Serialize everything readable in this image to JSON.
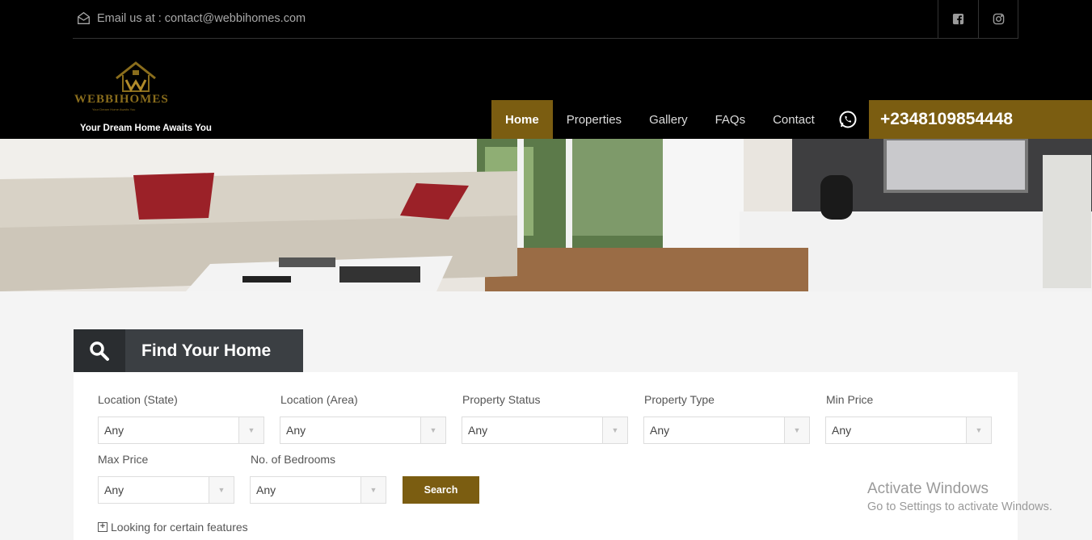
{
  "topbar": {
    "email_text": "Email us at : contact@webbihomes.com",
    "social": [
      "facebook-icon",
      "instagram-icon"
    ]
  },
  "brand": {
    "logo_word": "WEBBIHOMES",
    "logo_small": "Your Dream Home Awaits You",
    "tagline": "Your Dream Home Awaits You"
  },
  "nav": {
    "items": [
      {
        "label": "Home",
        "active": true
      },
      {
        "label": "Properties"
      },
      {
        "label": "Gallery"
      },
      {
        "label": "FAQs"
      },
      {
        "label": "Contact"
      }
    ],
    "phone": "+2348109854448"
  },
  "colors": {
    "accent": "#7b5d11",
    "header_bg": "#000000",
    "panel_dark": "#3b3f43"
  },
  "search": {
    "title": "Find Your Home",
    "fields": [
      {
        "label": "Location (State)",
        "value": "Any"
      },
      {
        "label": "Location (Area)",
        "value": "Any"
      },
      {
        "label": "Property Status",
        "value": "Any"
      },
      {
        "label": "Property Type",
        "value": "Any"
      },
      {
        "label": "Min Price",
        "value": "Any"
      },
      {
        "label": "Max Price",
        "value": "Any"
      },
      {
        "label": "No. of Bedrooms",
        "value": "Any"
      }
    ],
    "button": "Search",
    "features_link": "Looking for certain features"
  },
  "watermark": {
    "line1": "Activate Windows",
    "line2": "Go to Settings to activate Windows."
  }
}
